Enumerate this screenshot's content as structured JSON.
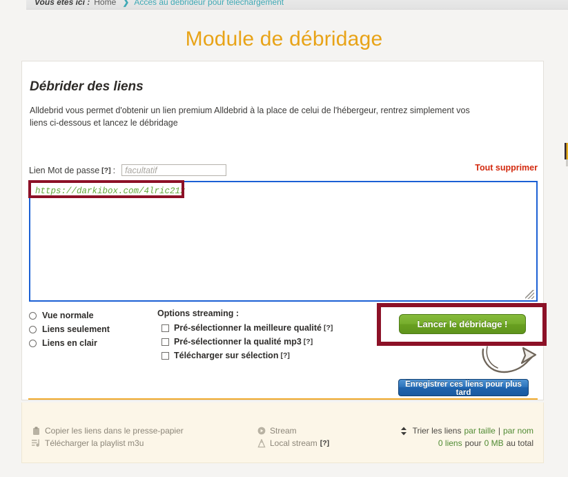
{
  "breadcrumb": {
    "label": "Vous êtes ici :",
    "home": "Home",
    "separator": "❯",
    "current": "Accès au débrideur pour téléchargement"
  },
  "page": {
    "title": "Module de débridage",
    "title_color": "#e8a317"
  },
  "panel": {
    "heading": "Débrider des liens",
    "description": "Alldebrid vous permet d'obtenir un lien premium Alldebrid à la place de celui de l'hébergeur, rentrez simplement vos liens ci-dessous et lancez le débridage"
  },
  "password_row": {
    "label": "Lien Mot de passe",
    "help": "[?]",
    "colon": ":",
    "placeholder": "facultatif",
    "value": ""
  },
  "clear_all": {
    "label": "Tout supprimer",
    "color": "#d32a0f"
  },
  "links_textarea": {
    "value": "https://darkibox.com/4lric21x",
    "placeholder": "",
    "text_color": "#63a93c",
    "border_color": "#1a5fd4"
  },
  "annotations": {
    "box_color": "#8c1127",
    "arrow": "hand-drawn-arrow"
  },
  "view_options": {
    "items": [
      {
        "label": "Vue normale",
        "selected": false
      },
      {
        "label": "Liens seulement",
        "selected": false
      },
      {
        "label": "Liens en clair",
        "selected": false
      }
    ]
  },
  "streaming_options": {
    "title": "Options streaming :",
    "items": [
      {
        "label": "Pré-sélectionner la meilleure qualité",
        "help": "[?]",
        "checked": false
      },
      {
        "label": "Pré-sélectionner la qualité mp3",
        "help": "[?]",
        "checked": false
      },
      {
        "label": "Télécharger sur sélection",
        "help": "[?]",
        "checked": false
      }
    ]
  },
  "buttons": {
    "launch": "Lancer le débridage !",
    "launch_color": "#76ad2c",
    "save": "Enregistrer ces liens pour plus tard",
    "save_color": "#2f76bd"
  },
  "footer": {
    "copy_links": "Copier les liens dans le presse-papier",
    "download_playlist": "Télécharger la playlist m3u",
    "stream": "Stream",
    "local_stream": "Local stream",
    "local_stream_help": "[?]",
    "sort_prefix": "Trier les liens",
    "sort_by_size": "par taille",
    "sort_divider": "|",
    "sort_by_name": "par nom",
    "total_count": "0 liens",
    "total_middle": "pour",
    "total_size": "0 MB",
    "total_suffix": "au total"
  }
}
